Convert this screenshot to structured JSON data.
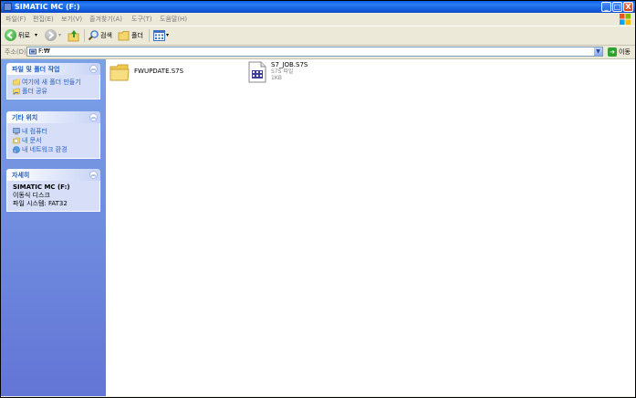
{
  "window": {
    "title": "SIMATIC MC (F:)"
  },
  "title_buttons": {
    "minimize": "_",
    "maximize": "□",
    "close": "X"
  },
  "menu": [
    "파일(F)",
    "편집(E)",
    "보기(V)",
    "즐겨찾기(A)",
    "도구(T)",
    "도움말(H)"
  ],
  "toolbar": {
    "back": "뒤로",
    "search": "검색",
    "folders": "폴더"
  },
  "address": {
    "label": "주소(D)",
    "value": "F:₩",
    "go": "이동"
  },
  "left_panels": {
    "file_tasks": {
      "title": "파일 및 폴더 작업",
      "items": [
        {
          "label": "여기에 새 폴더 만들기",
          "icon": "new-folder-icon"
        },
        {
          "label": "폴더 공유",
          "icon": "share-folder-icon"
        }
      ]
    },
    "other_places": {
      "title": "기타 위치",
      "items": [
        {
          "label": "내 컴퓨터",
          "icon": "my-computer-icon"
        },
        {
          "label": "내 문서",
          "icon": "my-documents-icon"
        },
        {
          "label": "내 네트워크 환경",
          "icon": "network-places-icon"
        }
      ]
    },
    "details": {
      "title": "자세히",
      "name": "SIMATIC MC (F:)",
      "type": "이동식 디스크",
      "filesystem": "파일 시스템: FAT32"
    }
  },
  "files": [
    {
      "name": "FWUPDATE.S7S",
      "kind": "folder",
      "icon": "folder-icon"
    },
    {
      "name": "S7_JOB.S7S",
      "type": "S7S 파일",
      "size": "1KB",
      "icon": "s7s-file-icon"
    }
  ],
  "colors": {
    "title_bar": "#0A5EE6",
    "left_pane": "#7BA2E7",
    "panel_title": "#215DC6"
  }
}
